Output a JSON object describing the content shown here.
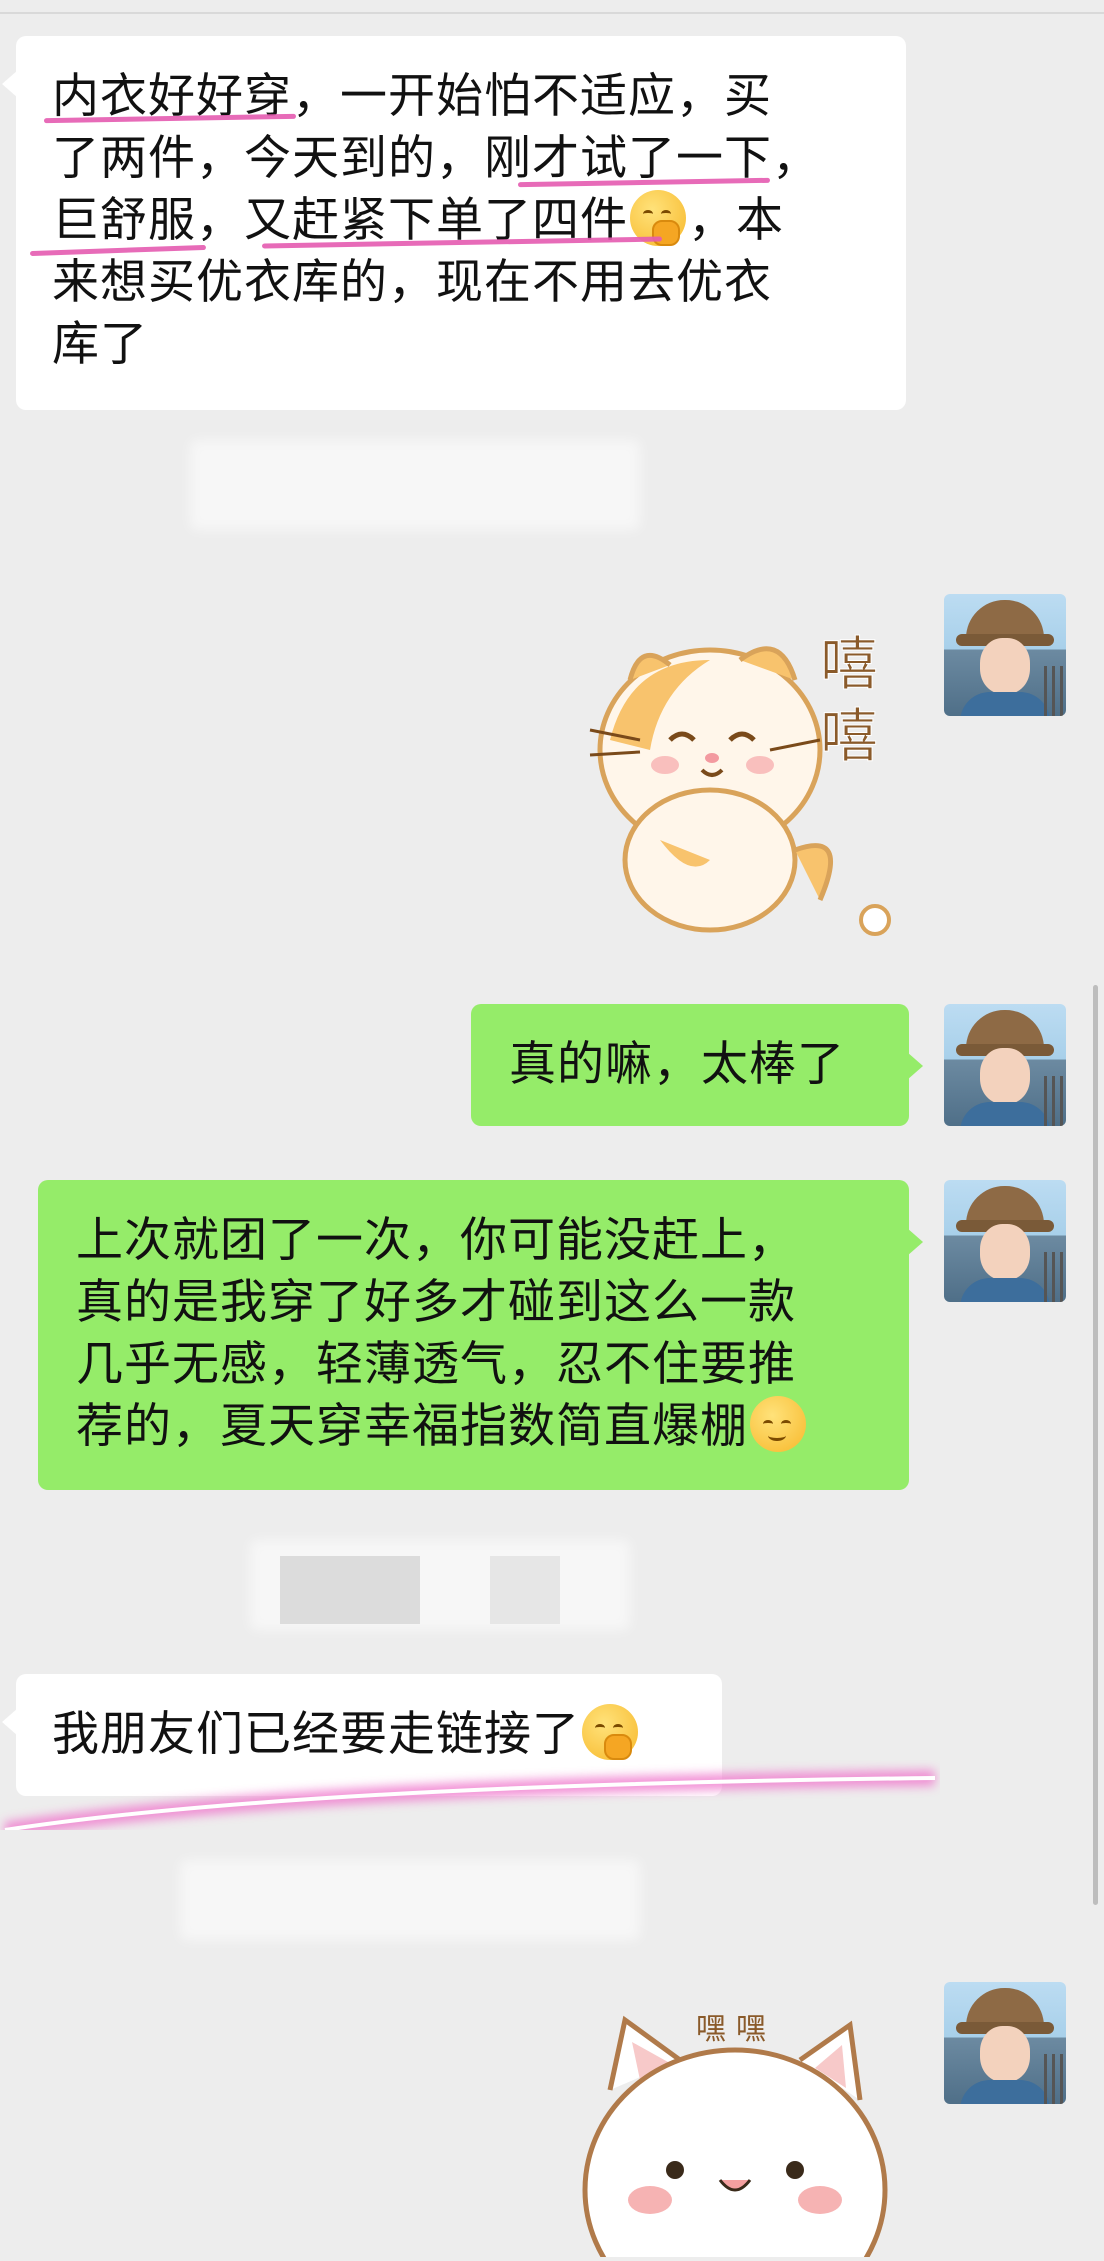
{
  "messages": [
    {
      "side": "left",
      "type": "text",
      "lines": [
        "内衣好好穿，一开始怕不适应，买",
        "了两件，今天到的，刚才试了一下，",
        "巨舒服，又赶紧下单了四件",
        "来想买优衣库的，现在不用去优衣",
        "库了"
      ],
      "line3_suffix": "，本"
    },
    {
      "side": "right",
      "type": "sticker",
      "caption": "嘻嘻"
    },
    {
      "side": "right",
      "type": "text",
      "lines": [
        "真的嘛，太棒了"
      ]
    },
    {
      "side": "right",
      "type": "text",
      "lines": [
        "上次就团了一次，你可能没赶上，",
        "真的是我穿了好多才碰到这么一款",
        "几乎无感，轻薄透气，忍不住要推",
        "荐的，夏天穿幸福指数简直爆棚"
      ]
    },
    {
      "side": "left",
      "type": "text",
      "lines": [
        "我朋友们已经要走链接了"
      ]
    },
    {
      "side": "right",
      "type": "sticker",
      "caption": "嘿嘿"
    }
  ],
  "icons": {
    "emoji_hand_over_mouth": "hand-over-mouth-emoji",
    "emoji_relieved": "relieved-face-emoji"
  },
  "colors": {
    "background": "#ededed",
    "received_bubble": "#ffffff",
    "sent_bubble": "#95ec69",
    "highlight": "#e45bb0"
  }
}
